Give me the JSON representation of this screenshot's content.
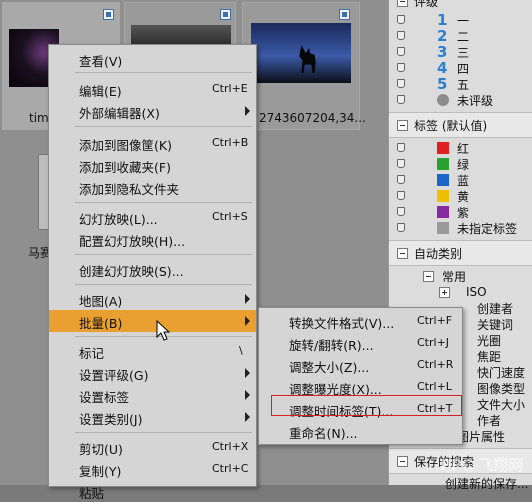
{
  "gallery": {
    "thumbs": [
      {
        "caption": "tim"
      },
      {
        "caption": ""
      },
      {
        "caption": "2743607204,34..."
      },
      {
        "caption": "马赛"
      }
    ]
  },
  "right_panel": {
    "top_label": "评级",
    "ratings": [
      {
        "num": "1",
        "label": "一"
      },
      {
        "num": "2",
        "label": "二"
      },
      {
        "num": "3",
        "label": "三"
      },
      {
        "num": "4",
        "label": "四"
      },
      {
        "num": "5",
        "label": "五"
      },
      {
        "num": "",
        "label": "未评级"
      }
    ],
    "labels_section": "标签 (默认值)",
    "labels": [
      {
        "label": "红",
        "color": "#e02020"
      },
      {
        "label": "绿",
        "color": "#2aa032"
      },
      {
        "label": "蓝",
        "color": "#1c64c8"
      },
      {
        "label": "黄",
        "color": "#f0c000"
      },
      {
        "label": "紫",
        "color": "#8a2aa0"
      },
      {
        "label": "未指定标签",
        "color": "#9a9a9a"
      }
    ],
    "auto_section": "自动类别",
    "auto_tree": {
      "root": "常用",
      "items": [
        "ISO",
        "创建者",
        "关键词",
        "光圈",
        "焦距",
        "快门速度",
        "图像类型",
        "文件大小",
        "作者",
        "图片属性"
      ]
    },
    "saved_section": "保存的搜索",
    "saved_sub": "创建新的保存..."
  },
  "context_menu": {
    "items": [
      {
        "label": "查看(V)",
        "shortcut": ""
      },
      {
        "label": "编辑(E)",
        "shortcut": "Ctrl+E"
      },
      {
        "label": "外部编辑器(X)",
        "shortcut": "",
        "submenu": true
      },
      {
        "label": "添加到图像筐(K)",
        "shortcut": "Ctrl+B"
      },
      {
        "label": "添加到收藏夹(F)",
        "shortcut": ""
      },
      {
        "label": "添加到隐私文件夹",
        "shortcut": ""
      },
      {
        "label": "幻灯放映(L)...",
        "shortcut": "Ctrl+S"
      },
      {
        "label": "配置幻灯放映(H)...",
        "shortcut": ""
      },
      {
        "label": "创建幻灯放映(S)...",
        "shortcut": ""
      },
      {
        "label": "地图(A)",
        "shortcut": "",
        "submenu": true
      },
      {
        "label": "批量(B)",
        "shortcut": "",
        "submenu": true
      },
      {
        "label": "标记",
        "shortcut": "\\",
        "submenu": false
      },
      {
        "label": "设置评级(G)",
        "shortcut": "",
        "submenu": true
      },
      {
        "label": "设置标签",
        "shortcut": "",
        "submenu": true
      },
      {
        "label": "设置类别(J)",
        "shortcut": "",
        "submenu": true
      },
      {
        "label": "剪切(U)",
        "shortcut": "Ctrl+X"
      },
      {
        "label": "复制(Y)",
        "shortcut": "Ctrl+C"
      },
      {
        "label": "粘贴",
        "shortcut": ""
      }
    ]
  },
  "batch_submenu": {
    "items": [
      {
        "label": "转换文件格式(V)...",
        "shortcut": "Ctrl+F"
      },
      {
        "label": "旋转/翻转(R)...",
        "shortcut": "Ctrl+J"
      },
      {
        "label": "调整大小(Z)...",
        "shortcut": "Ctrl+R"
      },
      {
        "label": "调整曝光度(X)...",
        "shortcut": "Ctrl+L"
      },
      {
        "label": "调整时间标签(T)...",
        "shortcut": "Ctrl+T"
      },
      {
        "label": "重命名(N)...",
        "shortcut": ""
      }
    ]
  },
  "watermark": "PPC 飞翔网"
}
